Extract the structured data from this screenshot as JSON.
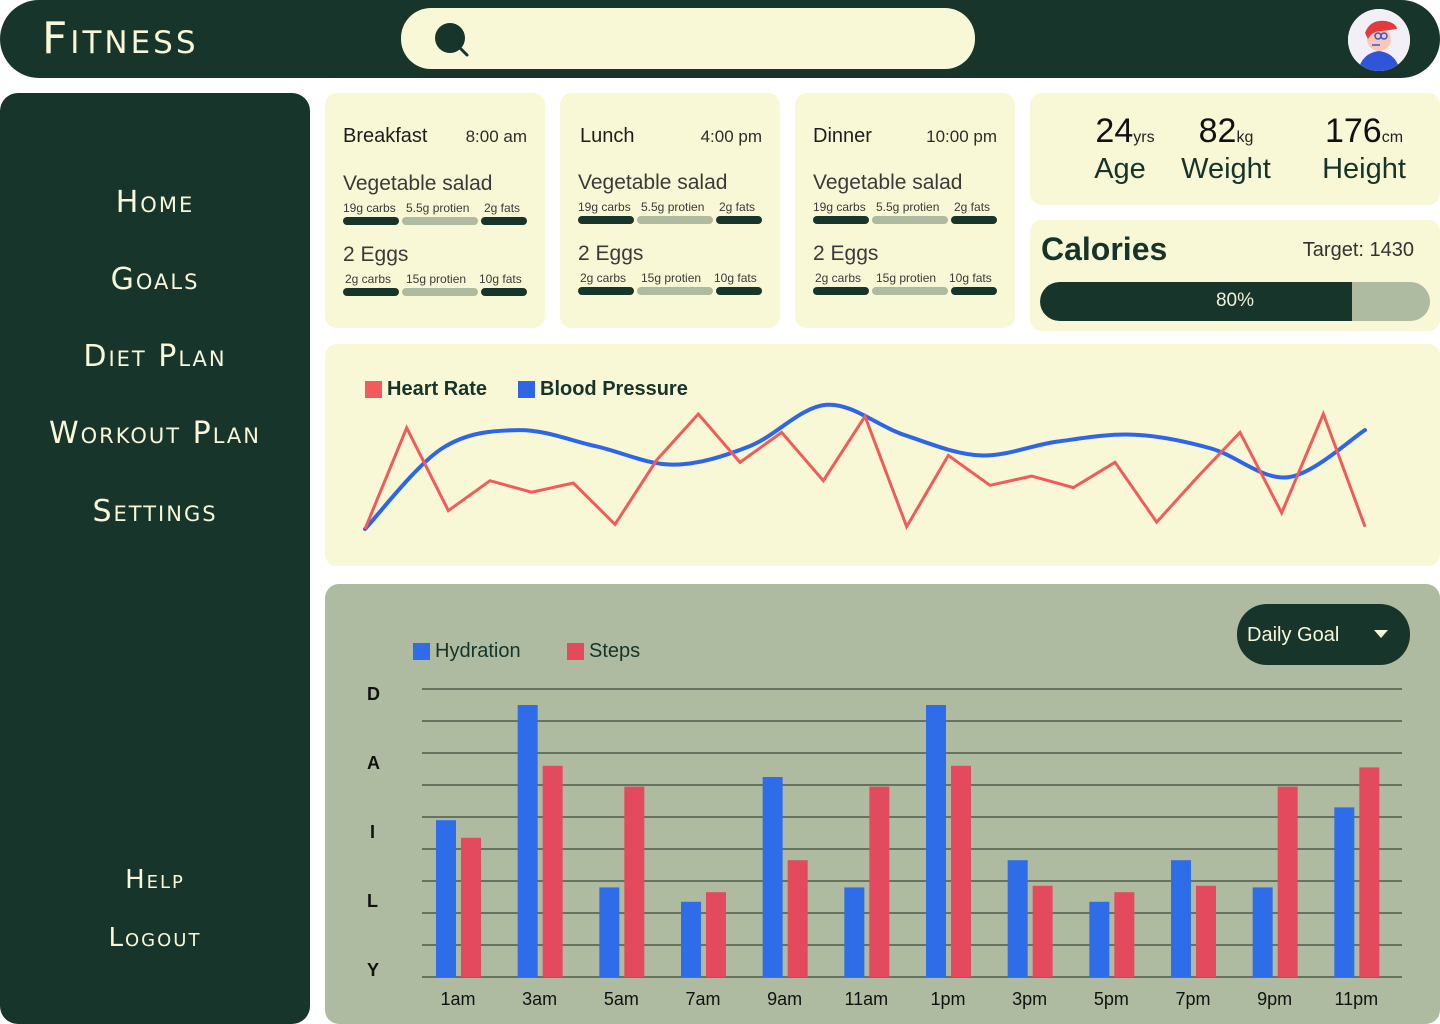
{
  "header": {
    "logo": "Fitness",
    "search": {
      "placeholder": ""
    }
  },
  "sidebar": {
    "items": [
      {
        "label": "Home"
      },
      {
        "label": "Goals"
      },
      {
        "label": "Diet Plan"
      },
      {
        "label": "Workout Plan"
      },
      {
        "label": "Settings"
      }
    ],
    "bottom_items": [
      {
        "label": "Help"
      },
      {
        "label": "Logout"
      }
    ]
  },
  "meals": [
    {
      "name": "Breakfast",
      "time": "8:00 am",
      "foods": [
        {
          "name": "Vegetable salad",
          "macros": [
            "19g carbs",
            "5.5g protien",
            "2g fats"
          ]
        },
        {
          "name": "2 Eggs",
          "macros": [
            "2g carbs",
            "15g protien",
            "10g fats"
          ]
        }
      ]
    },
    {
      "name": "Lunch",
      "time": "4:00 pm",
      "foods": [
        {
          "name": "Vegetable salad",
          "macros": [
            "19g carbs",
            "5.5g protien",
            "2g fats"
          ]
        },
        {
          "name": "2 Eggs",
          "macros": [
            "2g carbs",
            "15g protien",
            "10g fats"
          ]
        }
      ]
    },
    {
      "name": "Dinner",
      "time": "10:00 pm",
      "foods": [
        {
          "name": "Vegetable salad",
          "macros": [
            "19g carbs",
            "5.5g protien",
            "2g fats"
          ]
        },
        {
          "name": "2 Eggs",
          "macros": [
            "2g carbs",
            "15g protien",
            "10g fats"
          ]
        }
      ]
    }
  ],
  "stats": {
    "age": {
      "value": "24",
      "unit": "yrs",
      "label": "Age"
    },
    "weight": {
      "value": "82",
      "unit": "kg",
      "label": "Weight"
    },
    "height": {
      "value": "176",
      "unit": "cm",
      "label": "Height"
    }
  },
  "calories": {
    "title": "Calories",
    "target": "Target: 1430",
    "progress_text": "80%",
    "progress": 0.8
  },
  "colors": {
    "dark_green": "#17352a",
    "cream": "#f9f8d6",
    "sage": "#aebba0",
    "red": "#f15b5b",
    "blue": "#2f66e6",
    "bar_red": "#e34a5e",
    "bar_blue": "#2f6ce8"
  },
  "chart_data": [
    {
      "type": "line",
      "series": [
        {
          "name": "Heart Rate",
          "color": "#f15b5b",
          "values": [
            0,
            0.88,
            0.16,
            0.42,
            0.32,
            0.4,
            0.04,
            0.6,
            1.0,
            0.58,
            0.84,
            0.42,
            0.98,
            0.02,
            0.64,
            0.38,
            0.46,
            0.36,
            0.58,
            0.06,
            0.46,
            0.84,
            0.14,
            1.0,
            0.02
          ]
        },
        {
          "name": "Blood Pressure",
          "color": "#2f66e6",
          "values": [
            0.0,
            0.7,
            0.86,
            0.72,
            0.56,
            0.72,
            1.08,
            0.82,
            0.64,
            0.76,
            0.82,
            0.7,
            0.45,
            0.86
          ]
        }
      ]
    },
    {
      "type": "bar",
      "categories": [
        "1am",
        "3am",
        "5am",
        "7am",
        "9am",
        "11am",
        "1pm",
        "3pm",
        "5pm",
        "7pm",
        "9pm",
        "11pm"
      ],
      "y_tick_labels": [
        "D",
        "A",
        "I",
        "L",
        "Y"
      ],
      "ylim": [
        0,
        9
      ],
      "series": [
        {
          "name": "Hydration",
          "color": "#2f6ce8",
          "values": [
            4.9,
            8.5,
            2.8,
            2.35,
            6.25,
            2.8,
            8.5,
            3.65,
            2.35,
            3.65,
            2.8,
            5.3
          ]
        },
        {
          "name": "Steps",
          "color": "#e34a5e",
          "values": [
            4.35,
            6.6,
            5.95,
            2.65,
            3.65,
            5.95,
            6.6,
            2.85,
            2.65,
            2.85,
            5.95,
            6.55
          ]
        }
      ],
      "grid": true,
      "legend": "top-left"
    }
  ],
  "dropdown": {
    "selected": "Daily Goal"
  }
}
